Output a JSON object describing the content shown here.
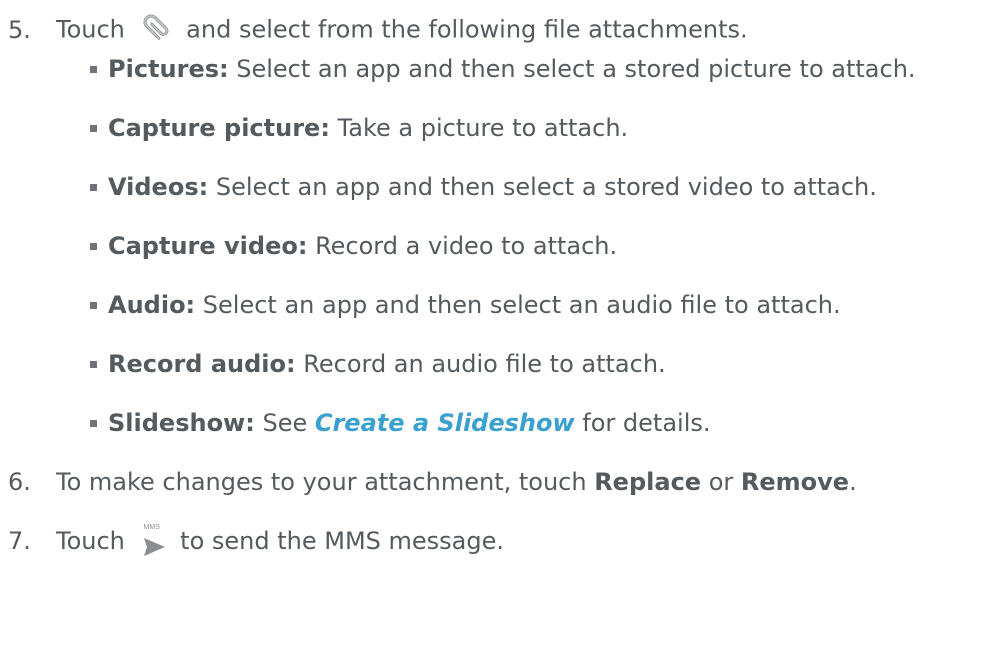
{
  "steps": [
    {
      "number": "5.",
      "before": "Touch",
      "icon": "paperclip-icon",
      "after": "and select from the following file attachments."
    },
    {
      "number": "6.",
      "before": "To make changes to your attachment, touch ",
      "bold1": "Replace",
      "middle": " or ",
      "bold2": "Remove",
      "after": "."
    },
    {
      "number": "7.",
      "before": "Touch",
      "icon": "mms-send-icon",
      "icon_label": "MMS",
      "after": "to send the MMS message."
    }
  ],
  "attachments": [
    {
      "term": "Pictures:",
      "desc": " Select an app and then select a stored picture to attach."
    },
    {
      "term": "Capture picture:",
      "desc": " Take a picture to attach."
    },
    {
      "term": "Videos:",
      "desc": " Select an app and then select a stored video to attach."
    },
    {
      "term": "Capture video:",
      "desc": " Record a video to attach."
    },
    {
      "term": "Audio:",
      "desc": " Select an app and then select an audio file to attach."
    },
    {
      "term": "Record audio:",
      "desc": " Record an audio file to attach."
    },
    {
      "term": "Slideshow:",
      "desc_before": " See ",
      "link": "Create a Slideshow",
      "desc_after": " for details."
    }
  ],
  "colors": {
    "text": "#555a5e",
    "link": "#3aa0d0",
    "bullet": "#707478"
  }
}
